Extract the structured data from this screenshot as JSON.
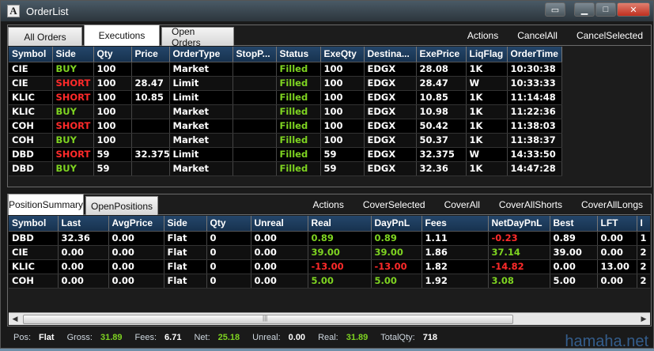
{
  "window": {
    "title": "OrderList",
    "icon_letter": "A"
  },
  "top_panel": {
    "tabs": [
      {
        "label": "All Orders"
      },
      {
        "label": "Executions"
      },
      {
        "label": "Open Orders"
      }
    ],
    "active_tab": 1,
    "actions": [
      "Actions",
      "CancelAll",
      "CancelSelected"
    ],
    "columns": [
      "Symbol",
      "Side",
      "Qty",
      "Price",
      "OrderType",
      "StopP...",
      "Status",
      "ExeQty",
      "Destina...",
      "ExePrice",
      "LiqFlag",
      "OrderTime"
    ],
    "rows": [
      [
        "CIE",
        "BUY",
        "100",
        "",
        "Market",
        "",
        "Filled",
        "100",
        "EDGX",
        "28.08",
        "1K",
        "10:30:38"
      ],
      [
        "CIE",
        "SHORT",
        "100",
        "28.47",
        "Limit",
        "",
        "Filled",
        "100",
        "EDGX",
        "28.47",
        "W",
        "10:33:33"
      ],
      [
        "KLIC",
        "SHORT",
        "100",
        "10.85",
        "Limit",
        "",
        "Filled",
        "100",
        "EDGX",
        "10.85",
        "1K",
        "11:14:48"
      ],
      [
        "KLIC",
        "BUY",
        "100",
        "",
        "Market",
        "",
        "Filled",
        "100",
        "EDGX",
        "10.98",
        "1K",
        "11:22:36"
      ],
      [
        "COH",
        "SHORT",
        "100",
        "",
        "Market",
        "",
        "Filled",
        "100",
        "EDGX",
        "50.42",
        "1K",
        "11:38:03"
      ],
      [
        "COH",
        "BUY",
        "100",
        "",
        "Market",
        "",
        "Filled",
        "100",
        "EDGX",
        "50.37",
        "1K",
        "11:38:37"
      ],
      [
        "DBD",
        "SHORT",
        "59",
        "32.375",
        "Limit",
        "",
        "Filled",
        "59",
        "EDGX",
        "32.375",
        "W",
        "14:33:50"
      ],
      [
        "DBD",
        "BUY",
        "59",
        "",
        "Market",
        "",
        "Filled",
        "59",
        "EDGX",
        "32.36",
        "1K",
        "14:47:28"
      ]
    ]
  },
  "bottom_panel": {
    "tabs": [
      {
        "label": "PositionSummary"
      },
      {
        "label": "OpenPositions"
      }
    ],
    "active_tab": 0,
    "actions": [
      "Actions",
      "CoverSelected",
      "CoverAll",
      "CoverAllShorts",
      "CoverAllLongs"
    ],
    "columns": [
      "Symbol",
      "Last",
      "AvgPrice",
      "Side",
      "Qty",
      "Unreal",
      "Real",
      "DayPnL",
      "Fees",
      "NetDayPnL",
      "Best",
      "LFT",
      "I"
    ],
    "rows": [
      [
        "DBD",
        "32.36",
        "0.00",
        "Flat",
        "0",
        "0.00",
        "0.89",
        "0.89",
        "1.11",
        "-0.23",
        "0.89",
        "0.00",
        "1"
      ],
      [
        "CIE",
        "0.00",
        "0.00",
        "Flat",
        "0",
        "0.00",
        "39.00",
        "39.00",
        "1.86",
        "37.14",
        "39.00",
        "0.00",
        "2"
      ],
      [
        "KLIC",
        "0.00",
        "0.00",
        "Flat",
        "0",
        "0.00",
        "-13.00",
        "-13.00",
        "1.82",
        "-14.82",
        "0.00",
        "13.00",
        "2"
      ],
      [
        "COH",
        "0.00",
        "0.00",
        "Flat",
        "0",
        "0.00",
        "5.00",
        "5.00",
        "1.92",
        "3.08",
        "5.00",
        "0.00",
        "2"
      ]
    ]
  },
  "status": {
    "pos_label": "Pos:",
    "pos": "Flat",
    "gross_label": "Gross:",
    "gross": "31.89",
    "fees_label": "Fees:",
    "fees": "6.71",
    "net_label": "Net:",
    "net": "25.18",
    "unreal_label": "Unreal:",
    "unreal": "0.00",
    "real_label": "Real:",
    "real": "31.89",
    "totalqty_label": "TotalQty:",
    "totalqty": "718"
  },
  "watermark": "hamaha.net",
  "colors": {
    "positive": "#7ed321",
    "negative": "#ff2a2a",
    "header": "#1f3d5e"
  }
}
